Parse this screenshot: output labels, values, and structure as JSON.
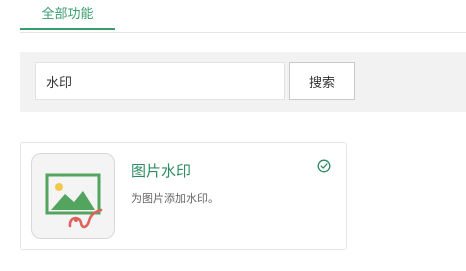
{
  "tabs": [
    {
      "label": "全部功能",
      "active": true
    }
  ],
  "search": {
    "value": "水印",
    "button_label": "搜索"
  },
  "plugins": [
    {
      "title": "图片水印",
      "description": "为图片添加水印。",
      "icon": "image-watermark-icon",
      "installed_icon": "check-circle-icon"
    }
  ],
  "colors": {
    "accent": "#3a9e6d",
    "title": "#2e8b63",
    "panel_bg": "#f2f2f2",
    "watermark_red": "#e0605a"
  }
}
